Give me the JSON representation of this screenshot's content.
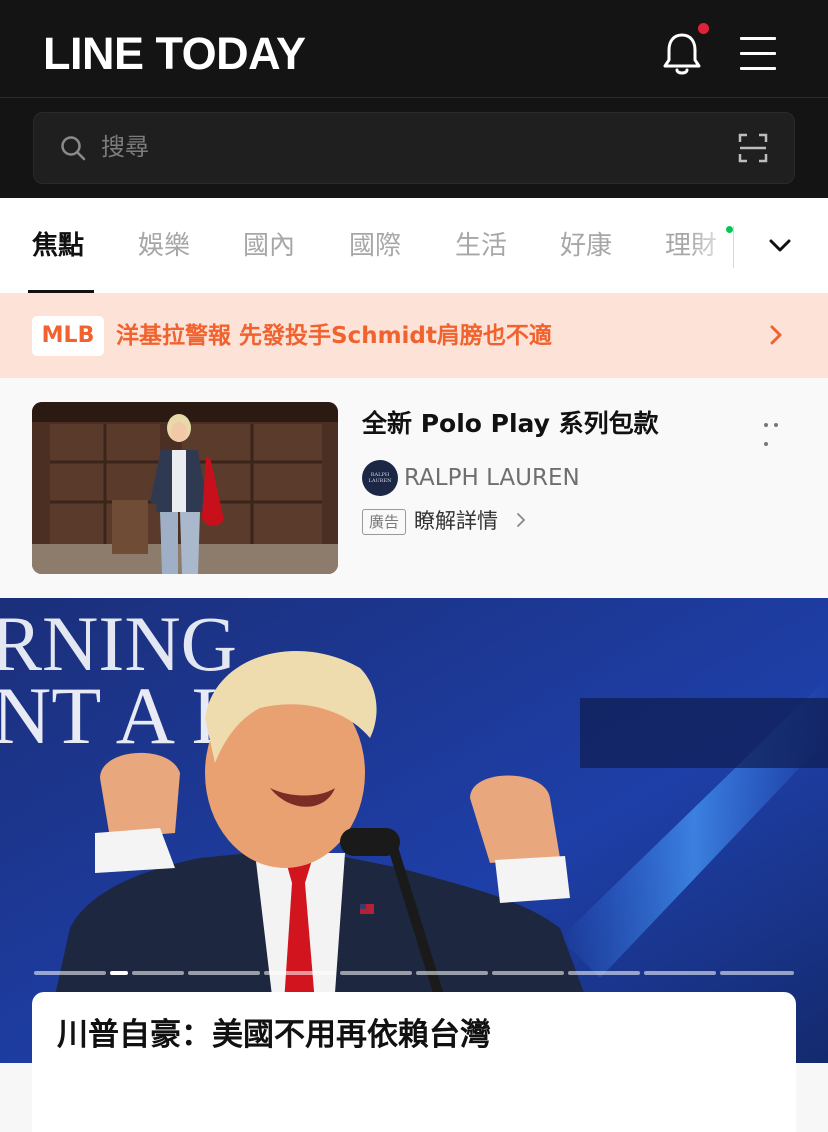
{
  "header": {
    "logo": "LINE TODAY",
    "notification_icon": "bell-icon",
    "menu_icon": "hamburger-menu-icon",
    "notification_dot_color": "#e0213a"
  },
  "search": {
    "placeholder": "搜尋",
    "icon": "search-icon",
    "scan_icon": "scan-icon"
  },
  "tabs": {
    "items": [
      "焦點",
      "娛樂",
      "國內",
      "國際",
      "生活",
      "好康",
      "理財"
    ],
    "active_index": 0,
    "expand_icon": "chevron-down-icon"
  },
  "alert": {
    "badge": "MLB",
    "text": "洋基拉警報 先發投手Schmidt肩膀也不適",
    "accent_color": "#f0622e"
  },
  "ad": {
    "title": "全新 Polo Play 系列包款",
    "brand_logo_text": "RALPH LAUREN",
    "brand": "RALPH LAUREN",
    "badge": "廣告",
    "cta": "瞭解詳情"
  },
  "hero": {
    "backdrop_text_line1": "RNING",
    "backdrop_text_line2": "NT A  ION",
    "slides_total": 10,
    "active_slide": 1,
    "headline": "川普自豪：美國不用再依賴台灣"
  }
}
